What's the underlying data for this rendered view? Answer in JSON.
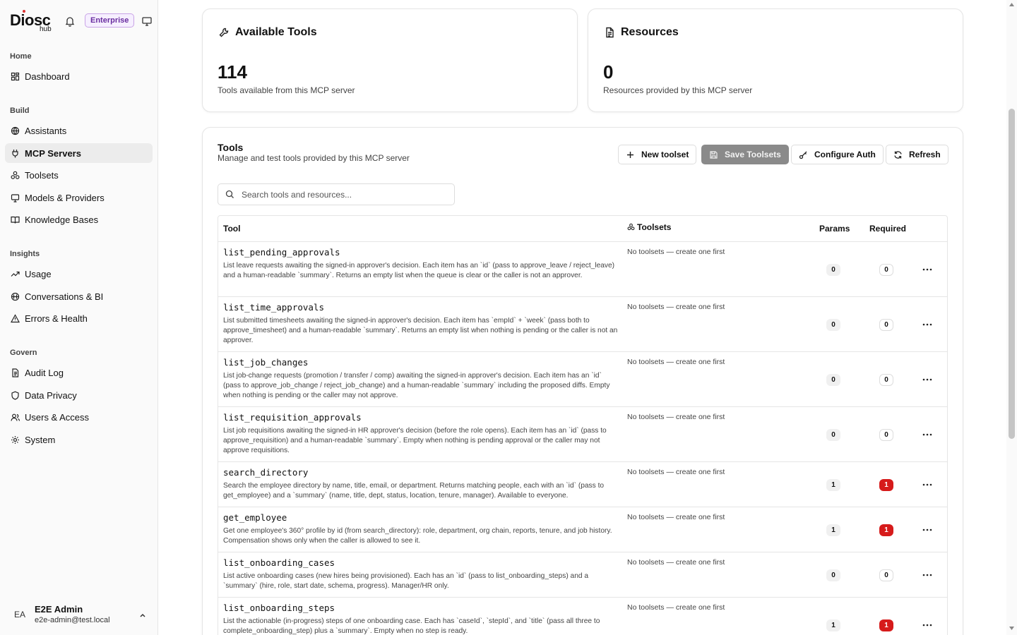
{
  "brand": {
    "name": "Diosc",
    "sub": "hub",
    "plan_badge": "Enterprise"
  },
  "sidebar": {
    "sections": [
      {
        "label": "Home",
        "items": [
          {
            "label": "Dashboard",
            "icon": "dashboard-icon"
          }
        ]
      },
      {
        "label": "Build",
        "items": [
          {
            "label": "Assistants",
            "icon": "globe-icon"
          },
          {
            "label": "MCP Servers",
            "icon": "plug-icon",
            "active": true
          },
          {
            "label": "Toolsets",
            "icon": "toolset-icon"
          },
          {
            "label": "Models & Providers",
            "icon": "monitor-icon"
          },
          {
            "label": "Knowledge Bases",
            "icon": "book-icon"
          }
        ]
      },
      {
        "label": "Insights",
        "items": [
          {
            "label": "Usage",
            "icon": "trend-icon"
          },
          {
            "label": "Conversations & BI",
            "icon": "chat-icon"
          },
          {
            "label": "Errors & Health",
            "icon": "warning-icon"
          }
        ]
      },
      {
        "label": "Govern",
        "items": [
          {
            "label": "Audit Log",
            "icon": "document-icon"
          },
          {
            "label": "Data Privacy",
            "icon": "shield-icon"
          },
          {
            "label": "Users & Access",
            "icon": "users-icon"
          },
          {
            "label": "System",
            "icon": "gear-icon"
          }
        ]
      }
    ]
  },
  "user": {
    "initials": "EA",
    "name": "E2E Admin",
    "email": "e2e-admin@test.local"
  },
  "stats": {
    "tools": {
      "title": "Available Tools",
      "value": "114",
      "desc": "Tools available from this MCP server"
    },
    "resources": {
      "title": "Resources",
      "value": "0",
      "desc": "Resources provided by this MCP server"
    }
  },
  "tools_panel": {
    "title": "Tools",
    "subtitle": "Manage and test tools provided by this MCP server",
    "buttons": {
      "new_toolset": "New toolset",
      "save_toolsets": "Save Toolsets",
      "configure_auth": "Configure Auth",
      "refresh": "Refresh"
    },
    "search_placeholder": "Search tools and resources...",
    "columns": {
      "tool": "Tool",
      "toolsets": "Toolsets",
      "params": "Params",
      "required": "Required"
    },
    "rows": [
      {
        "name": "list_pending_approvals",
        "desc": "List leave requests awaiting the signed-in approver's decision. Each item has an `id` (pass to approve_leave / reject_leave) and a human-readable `summary`. Returns an empty list when the queue is clear or the caller is not an approver.",
        "toolsets": "No toolsets — create one first",
        "params": "0",
        "required": "0"
      },
      {
        "name": "list_time_approvals",
        "desc": "List submitted timesheets awaiting the signed-in approver's decision. Each item has `empId` + `week` (pass both to approve_timesheet) and a human-readable `summary`. Returns an empty list when nothing is pending or the caller is not an approver.",
        "toolsets": "No toolsets — create one first",
        "params": "0",
        "required": "0"
      },
      {
        "name": "list_job_changes",
        "desc": "List job-change requests (promotion / transfer / comp) awaiting the signed-in approver's decision. Each item has an `id` (pass to approve_job_change / reject_job_change) and a human-readable `summary` including the proposed diffs. Empty when nothing is pending or the caller may not approve.",
        "toolsets": "No toolsets — create one first",
        "params": "0",
        "required": "0"
      },
      {
        "name": "list_requisition_approvals",
        "desc": "List job requisitions awaiting the signed-in HR approver's decision (before the role opens). Each item has an `id` (pass to approve_requisition) and a human-readable `summary`. Empty when nothing is pending approval or the caller may not approve requisitions.",
        "toolsets": "No toolsets — create one first",
        "params": "0",
        "required": "0"
      },
      {
        "name": "search_directory",
        "desc": "Search the employee directory by name, title, email, or department. Returns matching people, each with an `id` (pass to get_employee) and a `summary` (name, title, dept, status, location, tenure, manager). Available to everyone.",
        "toolsets": "No toolsets — create one first",
        "params": "1",
        "required": "1"
      },
      {
        "name": "get_employee",
        "desc": "Get one employee's 360° profile by id (from search_directory): role, department, org chain, reports, tenure, and job history. Compensation shows only when the caller is allowed to see it.",
        "toolsets": "No toolsets — create one first",
        "params": "1",
        "required": "1"
      },
      {
        "name": "list_onboarding_cases",
        "desc": "List active onboarding cases (new hires being provisioned). Each has an `id` (pass to list_onboarding_steps) and a `summary` (hire, role, start date, schema, progress). Manager/HR only.",
        "toolsets": "No toolsets — create one first",
        "params": "0",
        "required": "0"
      },
      {
        "name": "list_onboarding_steps",
        "desc": "List the actionable (in-progress) steps of one onboarding case. Each has `caseId`, `stepId`, and `title` (pass all three to complete_onboarding_step) plus a `summary`. Empty when no step is ready.",
        "toolsets": "No toolsets — create one first",
        "params": "1",
        "required": "1"
      }
    ]
  },
  "colors": {
    "accent_purple": "#6a2ea0",
    "required_red": "#d61b1b",
    "active_nav": "#ececec"
  }
}
